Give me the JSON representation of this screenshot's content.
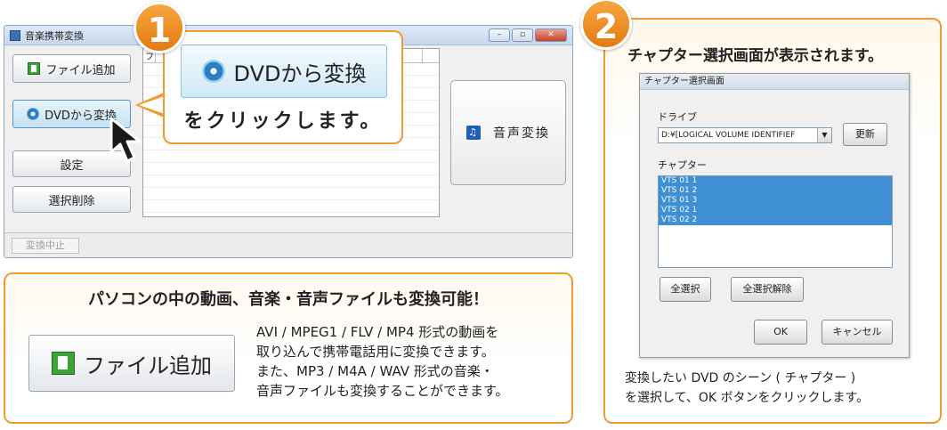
{
  "app_window": {
    "title": "音楽携帯変換",
    "buttons": {
      "add_file": "ファイル追加",
      "dvd_convert": "DVDから変換",
      "settings": "設定",
      "delete_selected": "選択削除",
      "convert_audio": "音声変換",
      "stop_convert": "変換中止"
    },
    "list_header_partial": "フ"
  },
  "step1": {
    "number": "1",
    "button_label": "DVDから変換",
    "instruction": "をクリックします。"
  },
  "info_box": {
    "title": "パソコンの中の動画、音楽・音声ファイルも変換可能！",
    "button_label": "ファイル追加",
    "lines": [
      "AVI / MPEG1 / FLV / MP4 形式の動画を",
      "取り込んで携帯電話用に変換できます。",
      "また、MP3 / M4A / WAV 形式の音楽・",
      "音声ファイルも変換することができます。"
    ]
  },
  "step2": {
    "number": "2",
    "title": "チャプター選択画面が表示されます。",
    "dialog": {
      "title": "チャプター選択画面",
      "drive_label": "ドライブ",
      "drive_value": "D:¥[LOGICAL VOLUME IDENTIFIEF",
      "refresh": "更新",
      "chapter_label": "チャプター",
      "chapters": [
        "VTS 01 1",
        "VTS 01 2",
        "VTS 01 3",
        "VTS 02 1",
        "VTS 02 2"
      ],
      "select_all": "全選択",
      "deselect_all": "全選択解除",
      "ok": "OK",
      "cancel": "キャンセル"
    },
    "caption_lines": [
      "変換したい DVD のシーン ( チャプター )",
      "を選択して、OK ボタンをクリックします。"
    ]
  },
  "colors": {
    "accent_orange": "#f09a34",
    "selection_blue": "#3f8fd5",
    "add_file_green": "#3aa33a"
  }
}
